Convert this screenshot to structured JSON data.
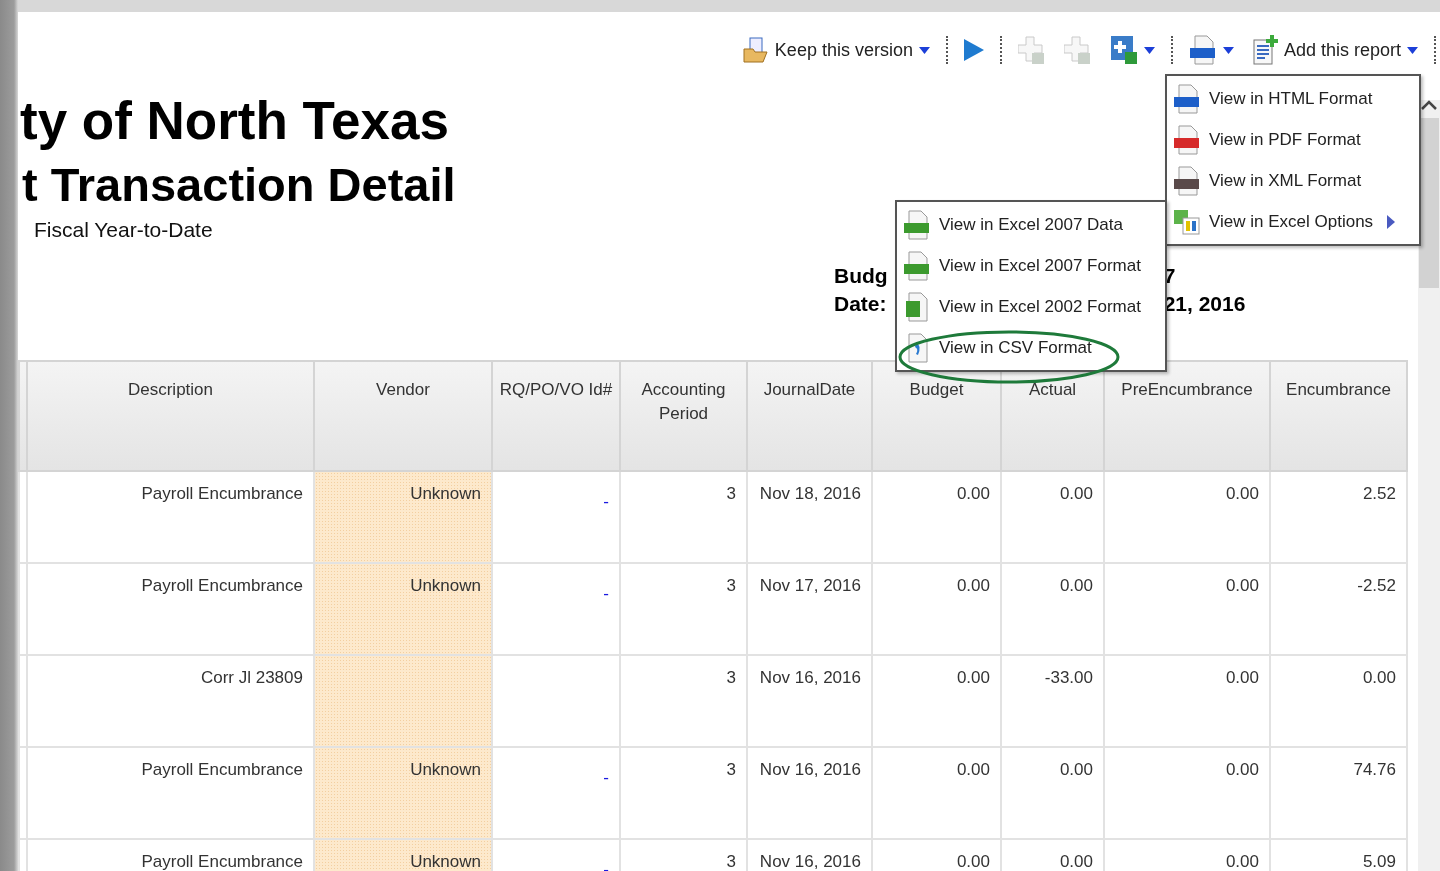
{
  "toolbar": {
    "keep_version": "Keep this version",
    "add_report": "Add this report",
    "tools": [
      {
        "disabled": true
      },
      {
        "disabled": true
      },
      {
        "disabled": false
      }
    ]
  },
  "report": {
    "title_lines": [
      "ty of North Texas",
      "t Transaction Detail"
    ],
    "subtitle": "Fiscal Year-to-Date",
    "info": [
      {
        "label": "Budg",
        "value": "7"
      },
      {
        "label": "Date:",
        "value": "21, 2016"
      }
    ]
  },
  "table": {
    "columns": [
      "Description",
      "Vendor",
      "RQ/PO/VO Id#",
      "Accounting Period",
      "JournalDate",
      "Budget",
      "Actual",
      "PreEncumbrance",
      "Encumbrance"
    ],
    "rows": [
      {
        "description": "Payroll Encumbrance",
        "vendor": "Unknown",
        "id": "-",
        "period": "3",
        "date": "Nov 18, 2016",
        "budget": "0.00",
        "actual": "0.00",
        "pre": "0.00",
        "enc": "2.52"
      },
      {
        "description": "Payroll Encumbrance",
        "vendor": "Unknown",
        "id": "-",
        "period": "3",
        "date": "Nov 17, 2016",
        "budget": "0.00",
        "actual": "0.00",
        "pre": "0.00",
        "enc": "-2.52"
      },
      {
        "description": "Corr Jl 23809",
        "period": "3",
        "date": "Nov 16, 2016",
        "budget": "0.00",
        "actual": "-33.00",
        "pre": "0.00",
        "enc": "0.00"
      },
      {
        "description": "Payroll Encumbrance",
        "vendor": "Unknown",
        "id": "-",
        "period": "3",
        "date": "Nov 16, 2016",
        "budget": "0.00",
        "actual": "0.00",
        "pre": "0.00",
        "enc": "74.76"
      },
      {
        "description": "Payroll Encumbrance",
        "vendor": "Unknown",
        "id": "-",
        "period": "3",
        "date": "Nov 16, 2016",
        "budget": "0.00",
        "actual": "0.00",
        "pre": "0.00",
        "enc": "5.09"
      }
    ]
  },
  "format_menu": {
    "items": [
      {
        "label": "View in HTML Format",
        "kind": "html"
      },
      {
        "label": "View in PDF Format",
        "kind": "pdf"
      },
      {
        "label": "View in XML Format",
        "kind": "xml"
      },
      {
        "label": "View in Excel Options",
        "kind": "excel-options",
        "submenu": true
      }
    ]
  },
  "excel_submenu": {
    "items": [
      {
        "label": "View in Excel 2007 Data",
        "kind": "excel07",
        "highlighted": false
      },
      {
        "label": "View in Excel 2007 Format",
        "kind": "excel07",
        "highlighted": false
      },
      {
        "label": "View in Excel 2002 Format",
        "kind": "excel02",
        "highlighted": false
      },
      {
        "label": "View in CSV Format",
        "kind": "csv",
        "highlighted": true
      }
    ]
  }
}
